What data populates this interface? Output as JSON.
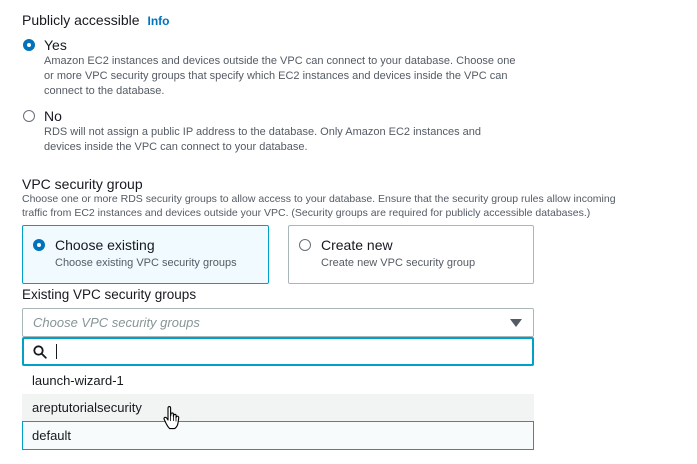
{
  "public_access": {
    "title": "Publicly accessible",
    "info": "Info",
    "yes": {
      "label": "Yes",
      "lines": [
        "Amazon EC2 instances and devices outside the VPC can connect to your database. Choose one",
        "or more VPC security groups that specify which EC2 instances and devices inside the VPC can",
        "connect to the database."
      ]
    },
    "no": {
      "label": "No",
      "lines": [
        "RDS will not assign a public IP address to the database. Only Amazon EC2 instances and",
        "devices inside the VPC can connect to your database."
      ]
    },
    "selected": "yes"
  },
  "vpc_security_group": {
    "title": "VPC security group",
    "lines": [
      "Choose one or more RDS security groups to allow access to your database. Ensure that the security group rules allow incoming",
      "traffic from EC2 instances and devices outside your VPC. (Security groups are required for publicly accessible databases.)"
    ],
    "choose_existing": {
      "label": "Choose existing",
      "sub": "Choose existing VPC security groups"
    },
    "create_new": {
      "label": "Create new",
      "sub": "Create new VPC security group"
    },
    "selected": "choose_existing"
  },
  "existing_groups": {
    "label": "Existing VPC security groups",
    "placeholder": "Choose VPC security groups",
    "search_value": "",
    "options": [
      "launch-wizard-1",
      "areptutorialsecurity",
      "default"
    ],
    "hovered_option": "areptutorialsecurity",
    "focused_option": "default"
  },
  "colors": {
    "accent": "#0073bb",
    "focus_border": "#00a1c9",
    "text": "#16191f",
    "muted_text": "#545b64"
  },
  "icons": [
    "search-icon",
    "caret-down-icon",
    "hand-pointer-icon"
  ]
}
